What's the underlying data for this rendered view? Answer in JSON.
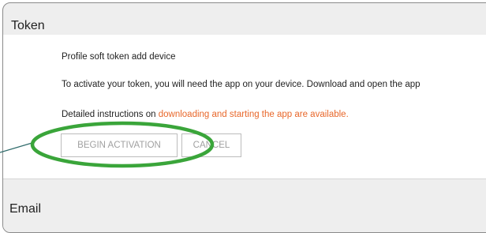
{
  "token_section": {
    "title": "Token",
    "profile_text": "Profile soft token add device",
    "activate_text": "To activate your token, you will need the app on your device. Download and open the app",
    "details_prefix": "Detailed instructions on ",
    "details_link": "downloading and starting the app are available.",
    "begin_button": "BEGIN ACTIVATION",
    "cancel_button": "CANCEL"
  },
  "email_section": {
    "title": "Email"
  },
  "colors": {
    "link": "#e8672a",
    "highlight": "#3aa53a",
    "callout_line": "#2f6b6b"
  }
}
